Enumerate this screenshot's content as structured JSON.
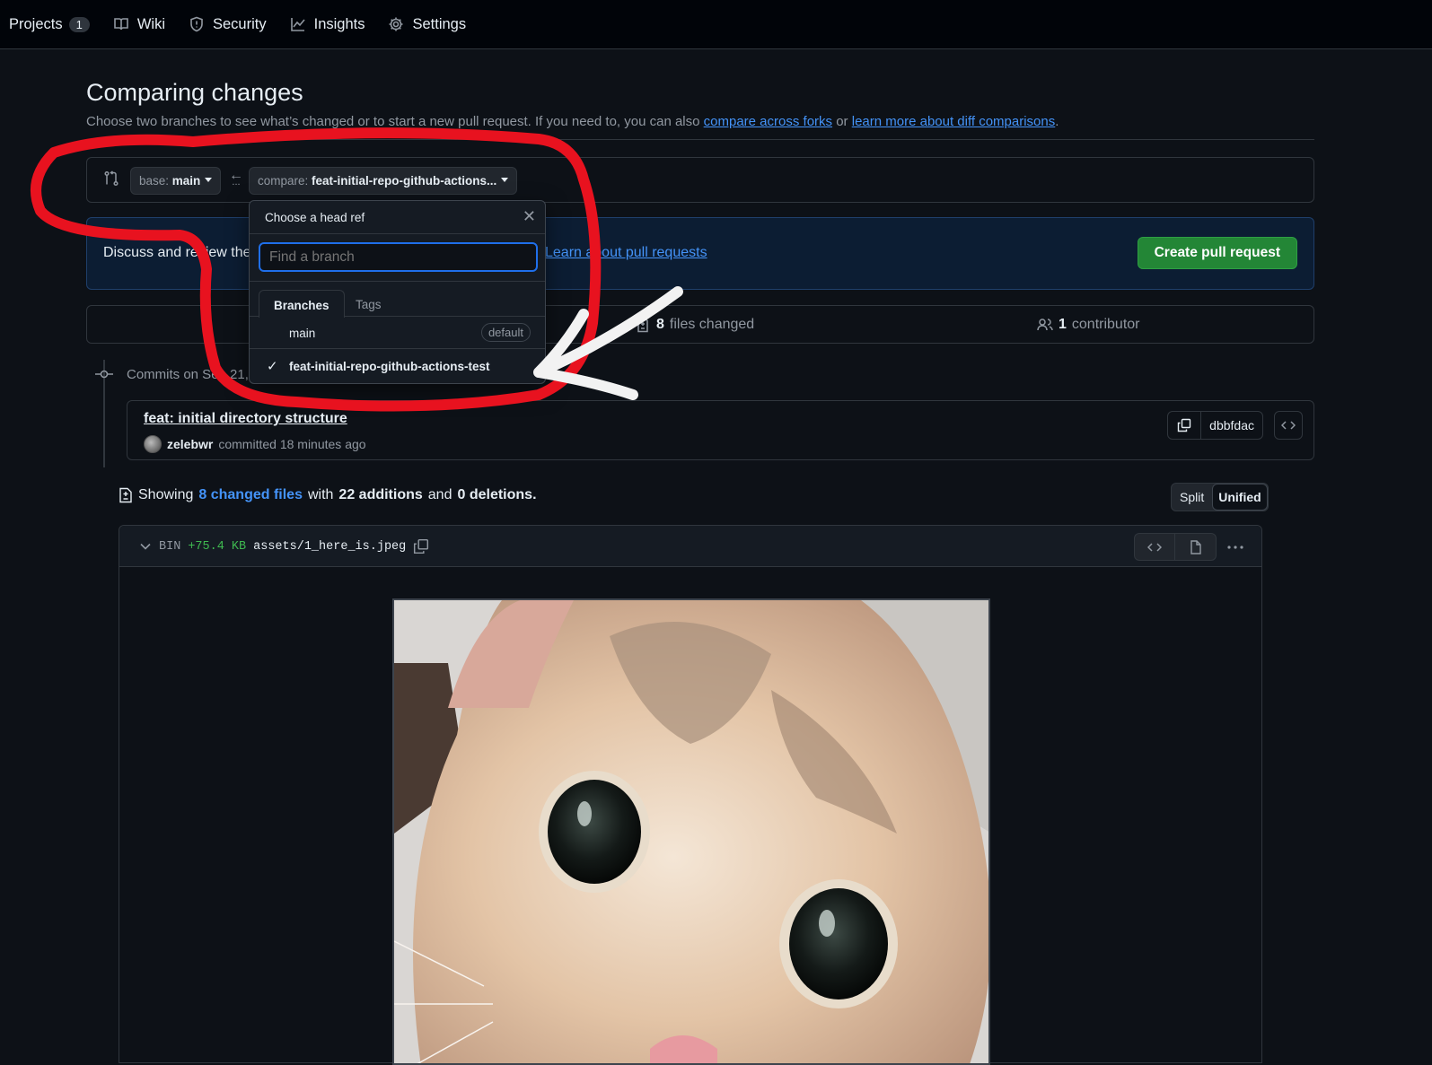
{
  "nav": {
    "items": [
      {
        "label": "Projects",
        "icon": "table-icon",
        "counter": "1"
      },
      {
        "label": "Wiki",
        "icon": "book-icon"
      },
      {
        "label": "Security",
        "icon": "shield-icon"
      },
      {
        "label": "Insights",
        "icon": "graph-icon"
      },
      {
        "label": "Settings",
        "icon": "gear-icon"
      }
    ]
  },
  "page": {
    "title": "Comparing changes",
    "subtitle_prefix": "Choose two branches to see what’s changed or to start a new pull request. If you need to, you can also ",
    "link_forks": "compare across forks",
    "subtitle_or": " or ",
    "link_learn": "learn more about diff comparisons",
    "subtitle_end": "."
  },
  "range": {
    "base_prefix": "base: ",
    "base_value": "main",
    "compare_prefix": "compare: ",
    "compare_value": "feat-initial-repo-github-actions...",
    "arrow": "←",
    "ellipsis": "..."
  },
  "flash": {
    "text": "Discuss and review the changes in this comparison with others.",
    "link": "Learn about pull requests",
    "create_button": "Create pull request"
  },
  "stats": {
    "files_count": "8",
    "files_label": " files changed",
    "contributors_count": "1",
    "contributors_label": " contributor"
  },
  "commits": {
    "heading": "Commits on Sep 21, 2023",
    "title": "feat: initial directory structure",
    "author": "zelebwr",
    "committed": " committed 18 minutes ago",
    "sha": "dbbfdac"
  },
  "diff": {
    "showing": "Showing",
    "changed_files": "8 changed files",
    "with": "with",
    "additions": "22 additions",
    "and": "and",
    "deletions": "0 deletions.",
    "split": "Split",
    "unified": "Unified",
    "file": {
      "bin": "BIN",
      "size_added": "+75.4 KB",
      "path": "assets/1_here_is.jpeg"
    }
  },
  "dropdown": {
    "title": "Choose a head ref",
    "search_placeholder": "Find a branch",
    "tab_branches": "Branches",
    "tab_tags": "Tags",
    "branches": [
      {
        "name": "main",
        "badge": "default",
        "selected": false
      },
      {
        "name": "feat-initial-repo-github-actions-test",
        "selected": true
      }
    ]
  },
  "colors": {
    "annotation_red": "#e8121f",
    "annotation_arrow": "#f2f2f2",
    "create_green": "#238636",
    "link_blue": "#4493f8"
  }
}
